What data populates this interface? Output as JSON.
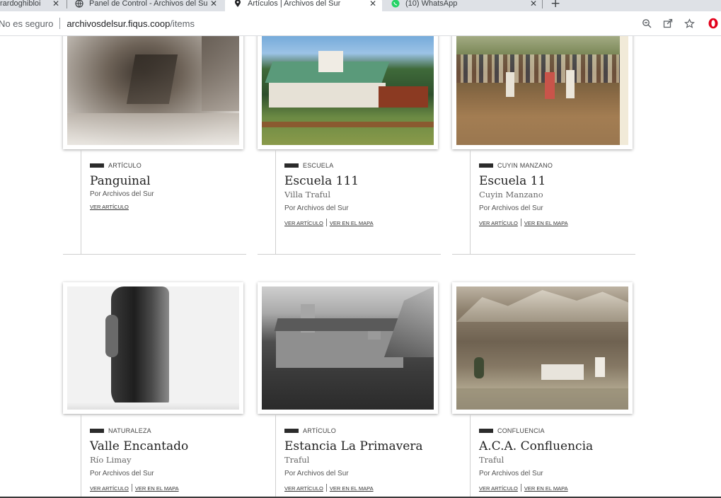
{
  "browser": {
    "tabs": [
      {
        "title": "rardoghibloi",
        "active": false
      },
      {
        "title": "Panel de Control - Archivos del Su",
        "active": false
      },
      {
        "title": "Artículos | Archivos del Sur",
        "active": true
      },
      {
        "title": "(10) WhatsApp",
        "active": false
      }
    ],
    "address": {
      "security": "No es seguro",
      "host": "archivosdelsur.fiqus.coop",
      "path": "/items"
    },
    "icons": [
      "zoom-icon",
      "share-icon",
      "star-icon",
      "opera-icon"
    ]
  },
  "cards": [
    {
      "category": "ARTÍCULO",
      "title": "Panguinal",
      "place": "",
      "author": "Por Archivos del Sur",
      "links": [
        "VER ARTÍCULO"
      ]
    },
    {
      "category": "ESCUELA",
      "title": "Escuela 111",
      "place": "Villa Traful",
      "author": "Por Archivos del Sur",
      "links": [
        "VER ARTÍCULO",
        "VER EN EL MAPA"
      ]
    },
    {
      "category": "CUYIN MANZANO",
      "title": "Escuela 11",
      "place": "Cuyin Manzano",
      "author": "Por Archivos del Sur",
      "links": [
        "VER ARTÍCULO",
        "VER EN EL MAPA"
      ]
    },
    {
      "category": "NATURALEZA",
      "title": "Valle Encantado",
      "place": "Río Limay",
      "author": "Por Archivos del Sur",
      "links": [
        "VER ARTÍCULO",
        "VER EN EL MAPA"
      ]
    },
    {
      "category": "ARTÍCULO",
      "title": "Estancia La Primavera",
      "place": "Traful",
      "author": "Por Archivos del Sur",
      "links": [
        "VER ARTÍCULO",
        "VER EN EL MAPA"
      ]
    },
    {
      "category": "CONFLUENCIA",
      "title": "A.C.A. Confluencia",
      "place": "Traful",
      "author": "Por Archivos del Sur",
      "links": [
        "VER ARTÍCULO",
        "VER EN EL MAPA"
      ]
    }
  ],
  "colors": {
    "accent": "#2b2b2b",
    "divider": "#cfcfcf",
    "tabbar": "#dee1e6",
    "opera": "#e3001b"
  }
}
